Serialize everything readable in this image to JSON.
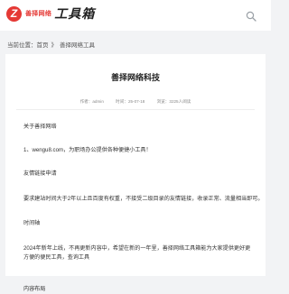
{
  "header": {
    "logo_mark": "Z",
    "logo_small": "善择网络",
    "logo_big": "工具箱"
  },
  "breadcrumb": {
    "label": "当前位置：",
    "home": "首页",
    "separator": "》",
    "current": "善择网络工具"
  },
  "article": {
    "title": "善择网络科技",
    "author": "作者：admin",
    "date": "时间：25-07-18",
    "views": "浏览：3225人阅读",
    "paragraphs": [
      "关于善择网络",
      "1、wengu8.com，为职场办公提供各种便捷小工具！",
      "友情链接申请",
      "要求建站时间大于2年以上且百度有权重，不接受二级目录的友情链接，收录正常、流量相当即可。",
      "时间轴",
      "2024年新年上线，不再更新内容中，希望在新的一年里，善择网络工具箱能为大家提供更好更方便的便民工具，查询工具",
      "内容布局"
    ]
  },
  "colors": {
    "brand_red": "#e53935",
    "page_bg": "#f2f3f5"
  },
  "icons": {
    "search": "search-icon"
  }
}
